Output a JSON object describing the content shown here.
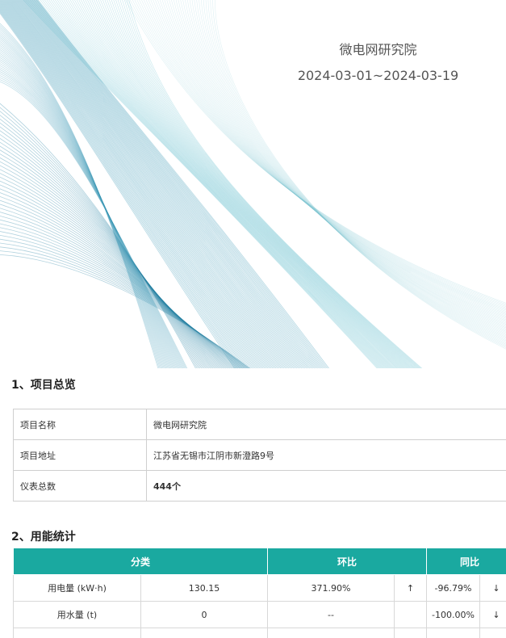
{
  "cover": {
    "org_name": "微电网研究院",
    "date_range": "2024-03-01~2024-03-19"
  },
  "section1": {
    "title": "1、项目总览",
    "rows": [
      {
        "label": "项目名称",
        "value": "微电网研究院"
      },
      {
        "label": "项目地址",
        "value": "江苏省无锡市江阴市新澄路9号"
      },
      {
        "label": "仪表总数",
        "value": "444个"
      }
    ]
  },
  "section2": {
    "title": "2、用能统计",
    "headers": {
      "category": "分类",
      "mom": "环比",
      "yoy": "同比"
    },
    "rows": [
      {
        "name": "用电量 (kW·h)",
        "value": "130.15",
        "mom": "371.90%",
        "mom_arrow": "↑",
        "yoy": "-96.79%",
        "yoy_arrow": "↓"
      },
      {
        "name": "用水量 (t)",
        "value": "0",
        "mom": "--",
        "mom_arrow": "",
        "yoy": "-100.00%",
        "yoy_arrow": "↓"
      }
    ]
  },
  "colors": {
    "header_teal": "#1aa9a0",
    "arrow_up": "#e53935",
    "arrow_down": "#2e9b3a"
  }
}
